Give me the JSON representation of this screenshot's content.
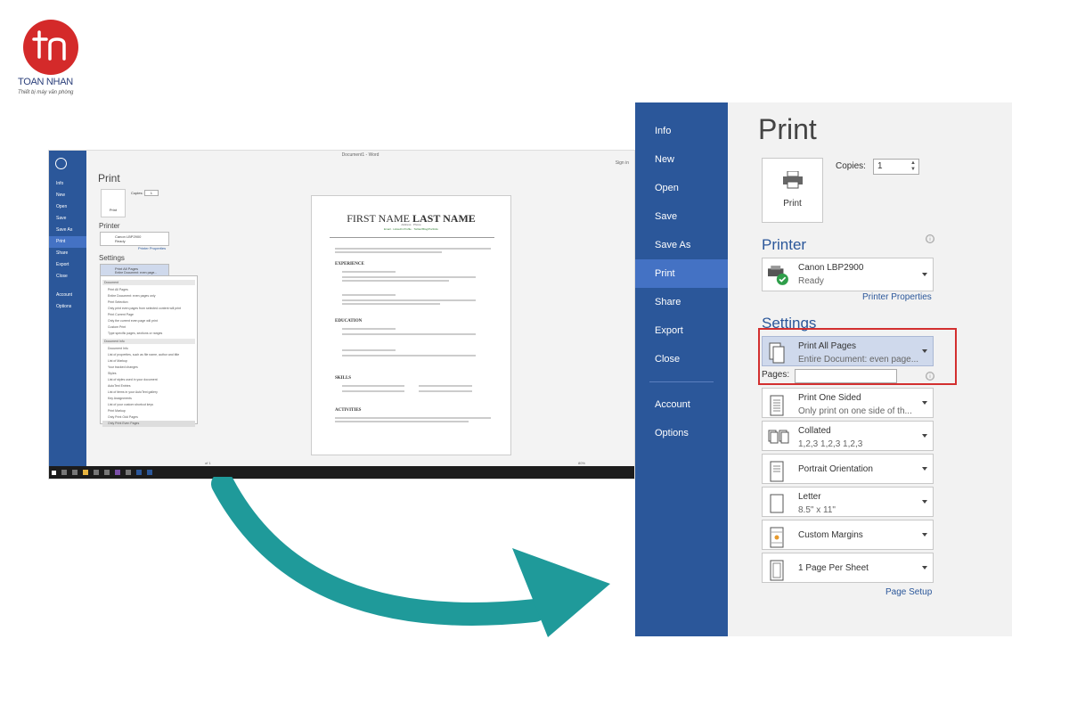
{
  "brand": {
    "name": "TOAN NHAN",
    "tagline": "Thiết bị máy văn phòng",
    "mono": "tn",
    "color": "#d42a2a"
  },
  "small": {
    "window_title": "Document1 - Word",
    "sign_in": "Sign in",
    "nav": [
      "Info",
      "New",
      "Open",
      "Save",
      "Save As",
      "Print",
      "Share",
      "Export",
      "Close",
      "Account",
      "Options"
    ],
    "print_title": "Print",
    "print_btn": "Print",
    "copies": "Copies:",
    "copies_val": "1",
    "printer_h": "Printer",
    "printer_name": "Canon LBP2900",
    "printer_status": "Ready",
    "printer_props": "Printer Properties",
    "settings_h": "Settings",
    "setting_main": "Print All Pages",
    "setting_sub": "Entire Document: even page...",
    "menu": {
      "hd1": "Document",
      "items1": [
        "Print All Pages",
        "Entire Document: even pages only",
        "Print Selection",
        "Only print even pages from selected content will print",
        "Print Current Page",
        "Only the current even page will print",
        "Custom Print",
        "Type specific pages, sections or ranges"
      ],
      "hd2": "Document Info",
      "items2": [
        "Document Info",
        "List of properties, such as file name, author and title",
        "List of Markup",
        "Your tracked changes",
        "Styles",
        "List of styles used in your document",
        "AutoText Entries",
        "List of items in your AutoText gallery",
        "Key Assignments",
        "List of your custom shortcut keys",
        "Print Markup",
        "Only Print Odd Pages",
        "Only Print Even Pages"
      ]
    },
    "doc": {
      "first": "FIRST NAME",
      "last": "LAST NAME",
      "contact": "Email · LinkedIn Profile · Twitter/Blog/Portfolio",
      "address": "Address · Phone",
      "sections": [
        "EXPERIENCE",
        "EDUCATION",
        "SKILLS",
        "ACTIVITIES"
      ]
    },
    "page_nav": "of 1",
    "zoom": "80%"
  },
  "word": {
    "nav": [
      "Info",
      "New",
      "Open",
      "Save",
      "Save As",
      "Print",
      "Share",
      "Export",
      "Close",
      "Account",
      "Options"
    ],
    "selected": "Print",
    "title": "Print",
    "print_btn": "Print",
    "copies_label": "Copies:",
    "copies_value": "1",
    "printer_heading": "Printer",
    "printer_name": "Canon LBP2900",
    "printer_status": "Ready",
    "printer_properties": "Printer Properties",
    "settings_heading": "Settings",
    "pages_label": "Pages:",
    "info_icon": "ⓘ",
    "dropdowns": [
      {
        "l1": "Print All Pages",
        "l2": "Entire Document: even page...",
        "icon": "pages-stack-icon"
      },
      {
        "l1": "Print One Sided",
        "l2": "Only print on one side of th...",
        "icon": "one-sided-icon"
      },
      {
        "l1": "Collated",
        "l2": "1,2,3    1,2,3    1,2,3",
        "icon": "collated-icon"
      },
      {
        "l1": "Portrait Orientation",
        "l2": "",
        "icon": "portrait-icon"
      },
      {
        "l1": "Letter",
        "l2": "8.5\" x 11\"",
        "icon": "letter-icon"
      },
      {
        "l1": "Custom Margins",
        "l2": "",
        "icon": "margins-icon"
      },
      {
        "l1": "1 Page Per Sheet",
        "l2": "",
        "icon": "page-per-sheet-icon"
      }
    ],
    "page_setup": "Page Setup",
    "colors": {
      "sidebar": "#2b579a",
      "selected": "#4472c4",
      "highlight": "#d32f2f",
      "arrow": "#1f9a9a"
    }
  }
}
